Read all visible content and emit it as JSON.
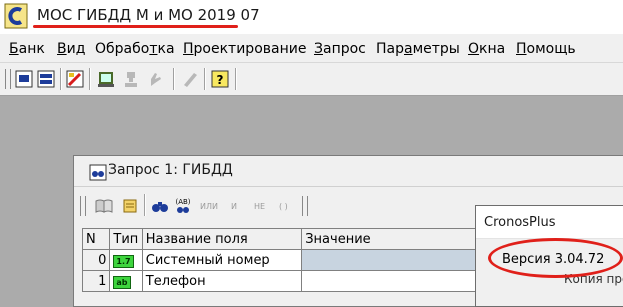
{
  "app": {
    "title": "МОС ГИБДД М и МО 2019 07"
  },
  "menu": {
    "items": [
      {
        "pre": "",
        "u": "Б",
        "post": "анк"
      },
      {
        "pre": "",
        "u": "В",
        "post": "ид"
      },
      {
        "pre": "Обрабо",
        "u": "т",
        "post": "ка"
      },
      {
        "pre": "",
        "u": "П",
        "post": "роектирование"
      },
      {
        "pre": "",
        "u": "З",
        "post": "апрос"
      },
      {
        "pre": "Пар",
        "u": "а",
        "post": "метры"
      },
      {
        "pre": "",
        "u": "О",
        "post": "кна"
      },
      {
        "pre": "",
        "u": "П",
        "post": "омощь"
      }
    ]
  },
  "query_window": {
    "title": "Запрос 1: ГИБДД",
    "toolbar_text": {
      "or": "ИЛИ",
      "and": "И",
      "not": "НЕ",
      "parens": "( )"
    },
    "columns": [
      "N",
      "Тип",
      "Название поля",
      "Значение"
    ],
    "rows": [
      {
        "n": "0",
        "type_badge": "1.7",
        "name": "Системный номер",
        "value": ""
      },
      {
        "n": "1",
        "type_badge": "ab",
        "name": "Телефон",
        "value": ""
      }
    ]
  },
  "about_dialog": {
    "title": "CronosPlus",
    "version": "Версия 3.04.72",
    "copy_fragment": "Копия прог"
  },
  "colors": {
    "annotation_red": "#e0201a",
    "badge_green": "#3ed53e",
    "mdi_background": "#ababab",
    "selected_cell": "#c8d4e0"
  }
}
